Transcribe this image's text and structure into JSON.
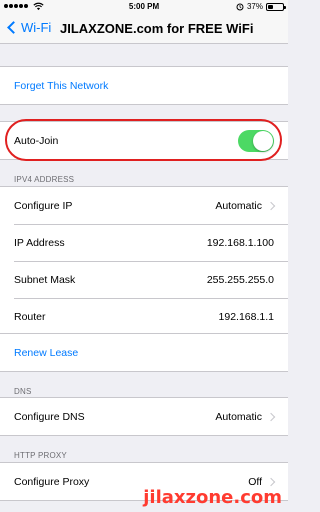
{
  "status_bar": {
    "carrier_icon": "signal-dots-icon",
    "time": "5:00 PM",
    "battery_percent": "37%",
    "battery_level": 0.37
  },
  "nav": {
    "back_label": "Wi-Fi",
    "title": "JILAXZONE.com for FREE WiFi"
  },
  "forget": {
    "label": "Forget This Network"
  },
  "auto_join": {
    "label": "Auto-Join",
    "enabled": true
  },
  "ipv4": {
    "header": "IPV4 ADDRESS",
    "rows": [
      {
        "label": "Configure IP",
        "value": "Automatic"
      },
      {
        "label": "IP Address",
        "value": "192.168.1.100"
      },
      {
        "label": "Subnet Mask",
        "value": "255.255.255.0"
      },
      {
        "label": "Router",
        "value": "192.168.1.1"
      }
    ]
  },
  "renew": {
    "label": "Renew Lease"
  },
  "dns": {
    "header": "DNS",
    "label": "Configure DNS",
    "value": "Automatic"
  },
  "proxy": {
    "header": "HTTP PROXY",
    "label": "Configure Proxy",
    "value": "Off"
  },
  "watermark": "jilaxzone.com",
  "colors": {
    "accent": "#007aff",
    "toggle_on": "#4cd964",
    "highlight": "#e02020"
  }
}
